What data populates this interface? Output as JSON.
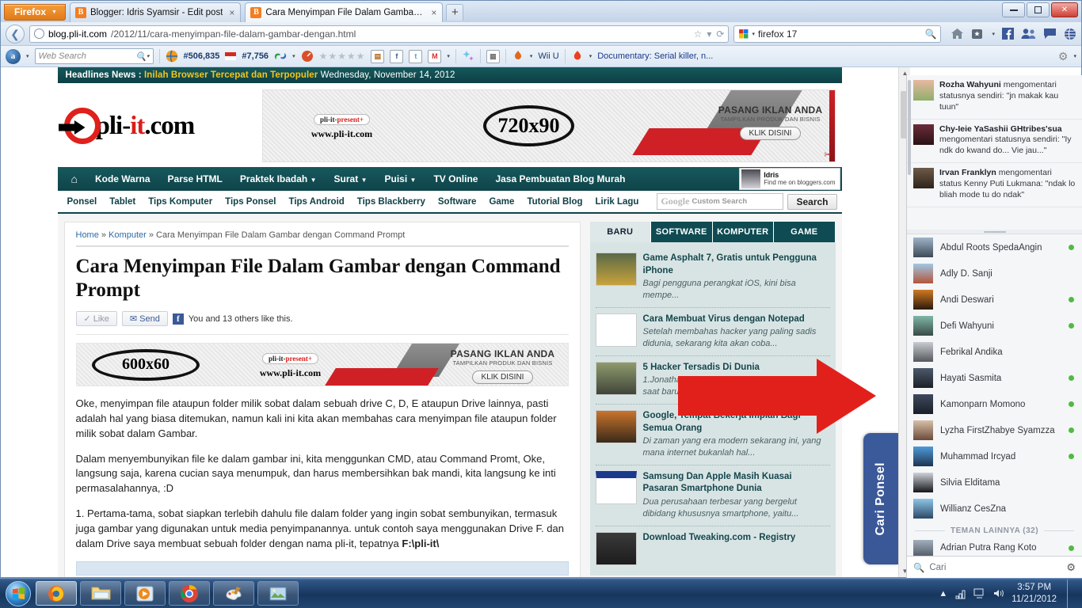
{
  "browser": {
    "firefox_button": "Firefox",
    "tabs": [
      {
        "title": "Blogger: Idris Syamsir - Edit post",
        "active": false
      },
      {
        "title": "Cara Menyimpan File Dalam Gambar ...",
        "active": true
      }
    ],
    "new_tab_label": "+",
    "window_controls": {
      "minimize": "minimize",
      "maximize": "maximize",
      "close": "✕"
    },
    "url_domain": "blog.pli-it.com",
    "url_path": "/2012/11/cara-menyimpan-file-dalam-gambar-dengan.html",
    "search_value": "firefox 17",
    "nav_icons": [
      "home-icon",
      "bookmarks-icon",
      "facebook-icon",
      "friends-icon",
      "messages-icon",
      "globe-icon"
    ]
  },
  "addonbar": {
    "alexa_label": "a",
    "web_search_placeholder": "Web Search",
    "rank_global": "#506,835",
    "rank_country": "#7,756",
    "wiiu_label": "Wii U",
    "feed_label": "Documentary: Serial killer, n..."
  },
  "site": {
    "headline_label": "Headlines News :",
    "headline_text": "Inilah Browser Tercepat dan Terpopuler",
    "headline_date": "Wednesday, November 14, 2012",
    "logo_left": "pli-",
    "logo_red": "it",
    "logo_right": ".com",
    "banner_top": {
      "tag_left": "pli-it-",
      "tag_right": "present+",
      "url": "www.pli-it.com",
      "size": "720x90",
      "cta_title": "PASANG IKLAN ANDA",
      "cta_sub": "TAMPILKAN PRODUK DAN BISNIS",
      "cta_button": "KLIK DISINI"
    },
    "banner_post": {
      "tag_left": "pli-it-",
      "tag_right": "present+",
      "url": "www.pli-it.com",
      "size": "600x60",
      "cta_title": "PASANG IKLAN ANDA",
      "cta_sub": "TAMPILKAN PRODUK DAN BISNIS",
      "cta_button": "KLIK DISINI"
    },
    "mainnav": [
      {
        "label": "",
        "icon": "home-icon",
        "dropdown": false
      },
      {
        "label": "Kode Warna",
        "dropdown": false
      },
      {
        "label": "Parse HTML",
        "dropdown": false
      },
      {
        "label": "Praktek Ibadah",
        "dropdown": true
      },
      {
        "label": "Surat",
        "dropdown": true
      },
      {
        "label": "Puisi",
        "dropdown": true
      },
      {
        "label": "TV Online",
        "dropdown": false
      },
      {
        "label": "Jasa Pembuatan Blog Murah",
        "dropdown": false
      }
    ],
    "profile": {
      "name": "Idris",
      "sub": "Find me on bloggers.com"
    },
    "subnav": [
      "Ponsel",
      "Tablet",
      "Tips Komputer",
      "Tips Ponsel",
      "Tips Android",
      "Tips Blackberry",
      "Software",
      "Game",
      "Tutorial Blog",
      "Lirik Lagu"
    ],
    "gsearch": {
      "brand": "Google",
      "tm": "™",
      "placeholder": "Custom Search",
      "button": "Search"
    }
  },
  "post": {
    "breadcrumb": [
      {
        "label": "Home",
        "link": true
      },
      {
        "label": "»",
        "link": false
      },
      {
        "label": "Komputer",
        "link": true
      },
      {
        "label": "» Cara Menyimpan File Dalam Gambar dengan Command Prompt",
        "link": false
      }
    ],
    "title": "Cara Menyimpan File Dalam Gambar dengan Command Prompt",
    "like_button": "Like",
    "send_button": "Send",
    "fb_text": "You and 13 others like this.",
    "paragraphs": [
      "Oke, menyimpan file ataupun folder milik sobat dalam sebuah drive C, D, E ataupun Drive lainnya, pasti adalah hal yang biasa ditemukan, namun kali ini kita akan membahas cara menyimpan file ataupun folder milik sobat dalam Gambar.",
      "Dalam menyembunyikan file ke dalam gambar ini, kita menggunkan CMD, atau Command Promt, Oke, langsung saja, karena cucian saya menumpuk, dan harus membersihkan bak mandi, kita langsung ke inti permasalahannya, :D"
    ],
    "step1_prefix": "1. Pertama-tama, sobat siapkan terlebih dahulu file dalam folder yang ingin sobat sembunyikan, termasuk juga gambar yang digunakan untuk media penyimpanannya. untuk contoh saya menggunakan Drive F. dan dalam Drive saya membuat sebuah folder dengan nama pli-it, tepatnya ",
    "step1_bold": "F:\\pli-it\\"
  },
  "widget": {
    "tabs": [
      {
        "label": "BARU",
        "active": true
      },
      {
        "label": "SOFTWARE",
        "active": false
      },
      {
        "label": "KOMPUTER",
        "active": false
      },
      {
        "label": "GAME",
        "active": false
      }
    ],
    "items": [
      {
        "title": "Game Asphalt 7, Gratis untuk Pengguna iPhone",
        "summary": "Bagi pengguna perangkat iOS, kini bisa mempe...",
        "thumb": "asphalt-thumb"
      },
      {
        "title": "Cara Membuat Virus dengan Notepad",
        "summary": "Setelah membahas hacker yang paling sadis didunia, sekarang kita akan coba...",
        "thumb": "pli-it-thumb"
      },
      {
        "title": "5 Hacker Tersadis Di Dunia",
        "summary": "1.Jonathan JamesJames adalah orang Amerika, saat baru umur 16 taun dia...",
        "thumb": "hacker-thumb"
      },
      {
        "title": "Google, Tempat Bekerja Impian Bagi Semua Orang",
        "summary": "Di zaman yang era modern sekarang ini, yang mana internet bukanlah hal...",
        "thumb": "google-thumb"
      },
      {
        "title": "Samsung Dan Apple Masih Kuasai Pasaran Smartphone Dunia",
        "summary": "Dua perusahaan terbesar yang bergelut dibidang khususnya smartphone, yaitu...",
        "thumb": "samsung-apple-thumb"
      },
      {
        "title": "Download Tweaking.com - Registry",
        "summary": "",
        "thumb": "registry-thumb"
      }
    ]
  },
  "overlay": {
    "arrow_color": "#e2201b",
    "cari_ponsel_label": "Cari Ponsel"
  },
  "facebook": {
    "ticker": [
      {
        "name": "Rozha Wahyuni",
        "text": "mengomentari statusnya sendiri: \"jn makak kau tuun\""
      },
      {
        "name": "Chy-Ieie YaSashii GHtribes'sua",
        "text": "mengomentari statusnya sendiri: \"Iy ndk do kwand do...\nVie jau...\""
      },
      {
        "name": "Irvan Franklyn",
        "text": "mengomentari status Kenny Puti Lukmana: \"ndak lo bliah mode tu do ndak\""
      }
    ],
    "friends": [
      {
        "name": "Abdul Roots SpedaAngin",
        "online": true
      },
      {
        "name": "Adly D. Sanji",
        "online": false
      },
      {
        "name": "Andi Deswari",
        "online": true
      },
      {
        "name": "Defi Wahyuni",
        "online": true
      },
      {
        "name": "Febrikal Andika",
        "online": false
      },
      {
        "name": "Hayati Sasmita",
        "online": true
      },
      {
        "name": "Kamonparn Momono",
        "online": true
      },
      {
        "name": "Lyzha FirstZhabye Syamzza",
        "online": true
      },
      {
        "name": "Muhammad Ircyad",
        "online": true
      },
      {
        "name": "Silvia Elditama",
        "online": false
      },
      {
        "name": "Willianz CesZna",
        "online": false
      }
    ],
    "section_label": "TEMAN LAINNYA (32)",
    "more_friend": {
      "name": "Adrian Putra Rang Koto",
      "online": true
    },
    "search_placeholder": "Cari",
    "settings_icon": "gear-icon"
  },
  "taskbar": {
    "start": "start-orb",
    "buttons": [
      "firefox-icon",
      "explorer-icon",
      "media-player-icon",
      "chrome-icon",
      "paint-icon",
      "photo-viewer-icon"
    ],
    "tray_icons": [
      "show-hidden-icon",
      "network-icon",
      "display-icon",
      "volume-icon"
    ],
    "time": "3:57 PM",
    "date": "11/21/2012"
  }
}
